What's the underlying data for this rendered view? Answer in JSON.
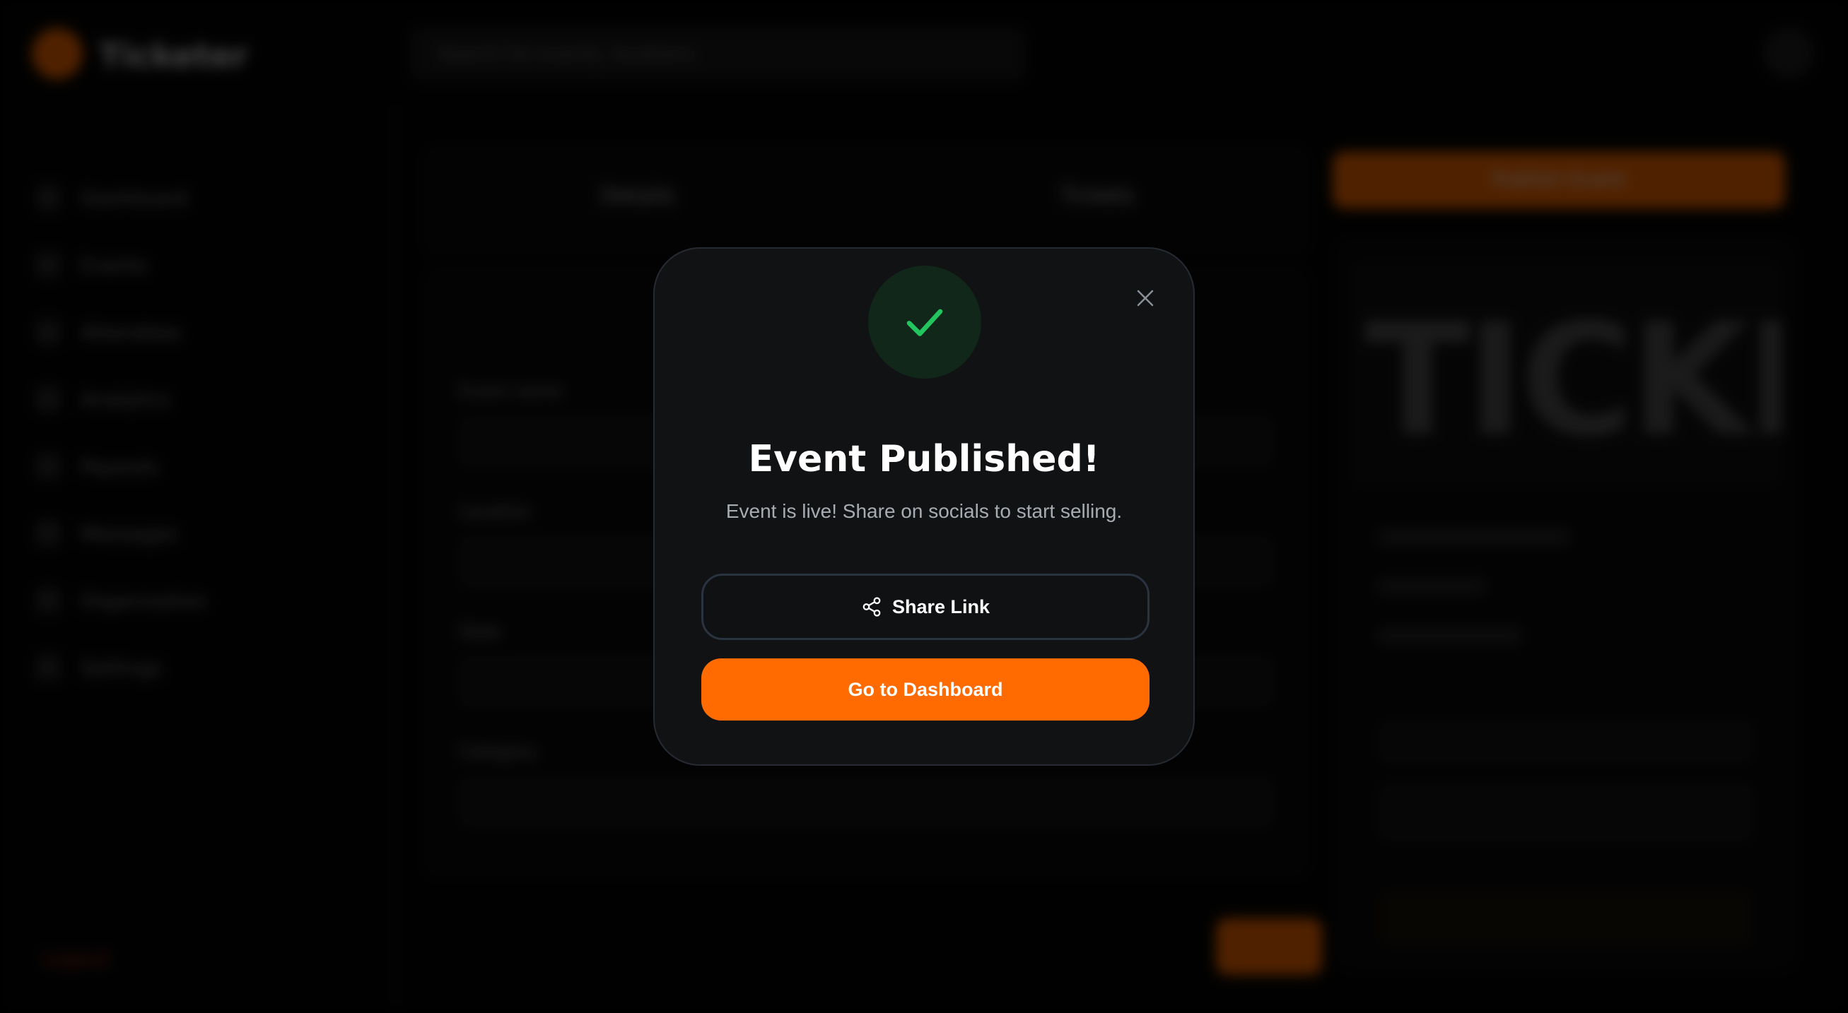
{
  "background": {
    "app_name": "Ticketer",
    "search_placeholder": "Search for events, locations",
    "sidebar_items": [
      "Dashboard",
      "Events",
      "Attendees",
      "Analytics",
      "Payouts",
      "Messages",
      "Organization",
      "Settings"
    ],
    "logout_label": "Logout",
    "tabs": [
      "Details",
      "Tickets"
    ],
    "primary_action": "Publish Event",
    "form_labels": [
      "Event name",
      "Location",
      "Date",
      "Category"
    ],
    "poster_text": "TICKET",
    "preview_heading": "Event Preview"
  },
  "modal": {
    "title": "Event Published!",
    "subtitle": "Event is live! Share on socials to start selling.",
    "share_label": "Share Link",
    "dashboard_label": "Go to Dashboard",
    "icons": {
      "success": "check-icon",
      "close": "close-icon",
      "share": "share-icon"
    }
  },
  "colors": {
    "accent": "#ff6b00",
    "success": "#22c55e",
    "modal_bg": "#111213"
  }
}
